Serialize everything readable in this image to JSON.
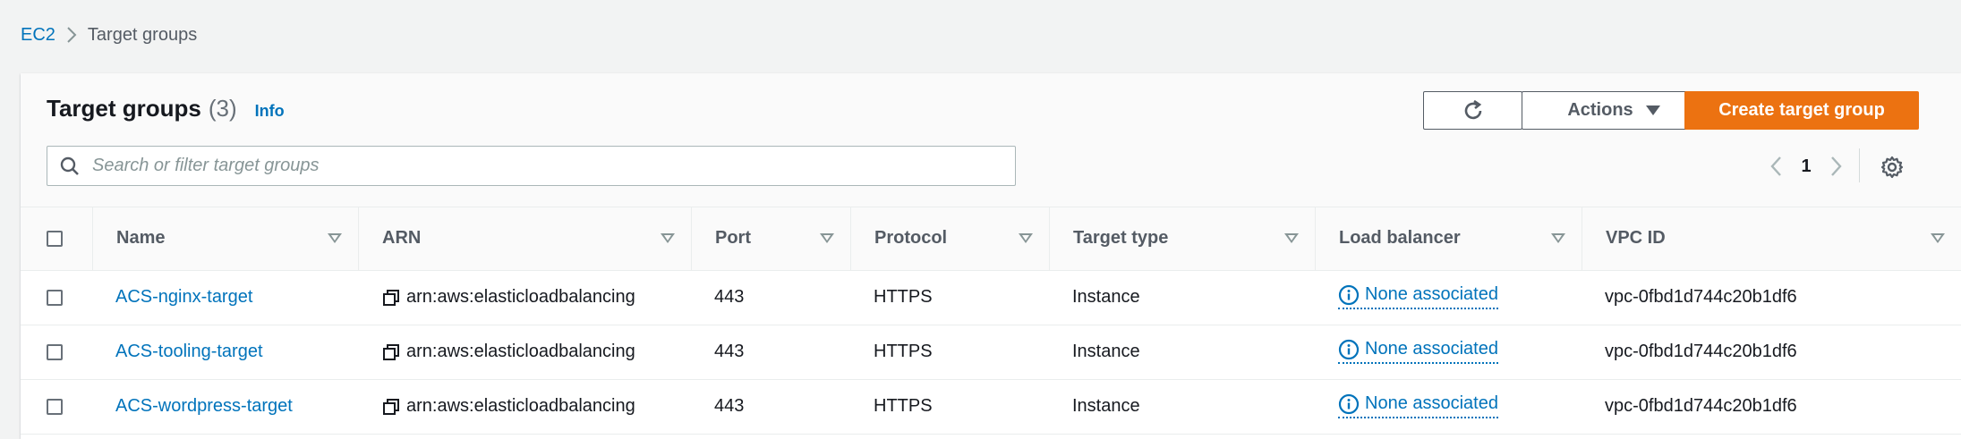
{
  "breadcrumb": {
    "root": "EC2",
    "current": "Target groups"
  },
  "header": {
    "title": "Target groups",
    "count": "(3)",
    "info": "Info"
  },
  "toolbar": {
    "actions_label": "Actions",
    "create_label": "Create target group"
  },
  "search": {
    "placeholder": "Search or filter target groups",
    "value": ""
  },
  "pagination": {
    "page": "1"
  },
  "colors": {
    "accent": "#0073bb",
    "primary_button": "#ec7211"
  },
  "table": {
    "columns": [
      "Name",
      "ARN",
      "Port",
      "Protocol",
      "Target type",
      "Load balancer",
      "VPC ID"
    ],
    "rows": [
      {
        "name": "ACS-nginx-target",
        "arn": "arn:aws:elasticloadbalancing",
        "port": "443",
        "protocol": "HTTPS",
        "target_type": "Instance",
        "load_balancer": "None associated",
        "vpc_id": "vpc-0fbd1d744c20b1df6"
      },
      {
        "name": "ACS-tooling-target",
        "arn": "arn:aws:elasticloadbalancing",
        "port": "443",
        "protocol": "HTTPS",
        "target_type": "Instance",
        "load_balancer": "None associated",
        "vpc_id": "vpc-0fbd1d744c20b1df6"
      },
      {
        "name": "ACS-wordpress-target",
        "arn": "arn:aws:elasticloadbalancing",
        "port": "443",
        "protocol": "HTTPS",
        "target_type": "Instance",
        "load_balancer": "None associated",
        "vpc_id": "vpc-0fbd1d744c20b1df6"
      }
    ]
  }
}
